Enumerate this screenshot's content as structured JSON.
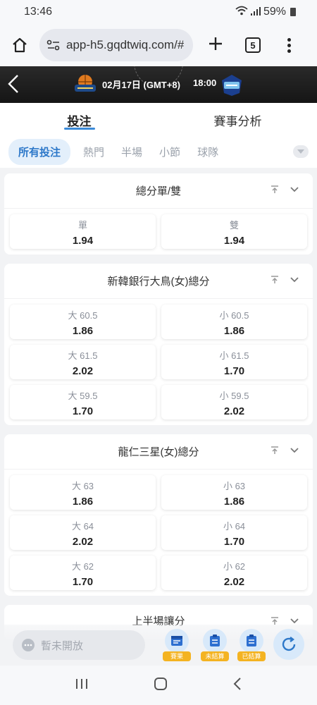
{
  "status_bar": {
    "time": "13:46",
    "battery": "59%"
  },
  "browser": {
    "url": "app-h5.gqdtwiq.com/#",
    "tab_count": "5"
  },
  "match": {
    "date": "02月17日 (GMT+8)",
    "time": "18:00"
  },
  "main_tabs": [
    {
      "label": "投注",
      "active": true
    },
    {
      "label": "賽事分析",
      "active": false
    }
  ],
  "sub_tabs": [
    {
      "label": "所有投注",
      "active": true
    },
    {
      "label": "熱門"
    },
    {
      "label": "半場"
    },
    {
      "label": "小節"
    },
    {
      "label": "球隊"
    }
  ],
  "markets": [
    {
      "title": "總分單/雙",
      "rows": [
        [
          {
            "label": "單",
            "odds": "1.94"
          },
          {
            "label": "雙",
            "odds": "1.94"
          }
        ]
      ]
    },
    {
      "title": "新韓銀行大鳥(女)總分",
      "rows": [
        [
          {
            "label": "大 60.5",
            "odds": "1.86"
          },
          {
            "label": "小 60.5",
            "odds": "1.86"
          }
        ],
        [
          {
            "label": "大 61.5",
            "odds": "2.02"
          },
          {
            "label": "小 61.5",
            "odds": "1.70"
          }
        ],
        [
          {
            "label": "大 59.5",
            "odds": "1.70"
          },
          {
            "label": "小 59.5",
            "odds": "2.02"
          }
        ]
      ]
    },
    {
      "title": "龍仁三星(女)總分",
      "rows": [
        [
          {
            "label": "大 63",
            "odds": "1.86"
          },
          {
            "label": "小 63",
            "odds": "1.86"
          }
        ],
        [
          {
            "label": "大 64",
            "odds": "2.02"
          },
          {
            "label": "小 64",
            "odds": "1.70"
          }
        ],
        [
          {
            "label": "大 62",
            "odds": "1.70"
          },
          {
            "label": "小 62",
            "odds": "2.02"
          }
        ]
      ]
    },
    {
      "title": "上半場讓分",
      "rows": []
    }
  ],
  "bottom": {
    "chat_placeholder": "暫未開放",
    "results_label": "賽果",
    "unsettled_label": "未結算",
    "settled_label": "已結算"
  },
  "colors": {
    "accent": "#3a8ad8",
    "badge": "#f4b321",
    "banner": "#1c1c1c"
  }
}
